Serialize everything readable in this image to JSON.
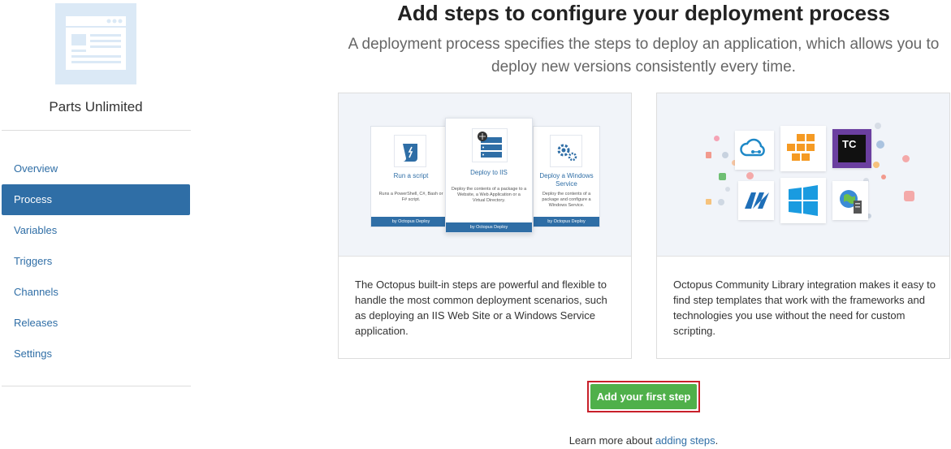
{
  "project": {
    "name": "Parts Unlimited",
    "logo_icon": "browser-window-icon"
  },
  "nav": [
    {
      "label": "Overview",
      "active": false
    },
    {
      "label": "Process",
      "active": true
    },
    {
      "label": "Variables",
      "active": false
    },
    {
      "label": "Triggers",
      "active": false
    },
    {
      "label": "Channels",
      "active": false
    },
    {
      "label": "Releases",
      "active": false
    },
    {
      "label": "Settings",
      "active": false
    }
  ],
  "heading": {
    "title": "Add steps to configure your deployment process",
    "subtitle": "A deployment process specifies the steps to deploy an application, which allows you to deploy new versions consistently every time."
  },
  "builtin_card": {
    "description": "The Octopus built-in steps are powerful and flexible to handle the most common deployment scenarios, such as deploying an IIS Web Site or a Windows Service application.",
    "steps": [
      {
        "title": "Run a script",
        "desc": "Runs a PowerShell, C#, Bash or F# script.",
        "footer": "by Octopus Deploy",
        "icon": "script-icon"
      },
      {
        "title": "Deploy to IIS",
        "desc": "Deploy the contents of a package to a Website, a Web Application or a Virtual Directory.",
        "footer": "by Octopus Deploy",
        "icon": "server-globe-icon"
      },
      {
        "title": "Deploy a Windows Service",
        "desc": "Deploy the contents of a package and configure a Windows Service.",
        "footer": "by Octopus Deploy",
        "icon": "gears-icon"
      }
    ]
  },
  "community_card": {
    "description": "Octopus Community Library integration makes it easy to find step templates that work with the frameworks and technologies you use without the need for custom scripting.",
    "tile_icons": [
      "azure-cloud-icon",
      "aws-icon",
      "teamcity-icon",
      "dotnet-icon",
      "windows-icon",
      "server-globe-icon"
    ],
    "tc_label": "TC"
  },
  "cta": {
    "label": "Add your first step"
  },
  "learn": {
    "prefix": "Learn more about ",
    "link": "adding steps",
    "suffix": "."
  },
  "colors": {
    "accent": "#2f6ea6",
    "button": "#4fb04a",
    "highlight": "#c8202a"
  }
}
